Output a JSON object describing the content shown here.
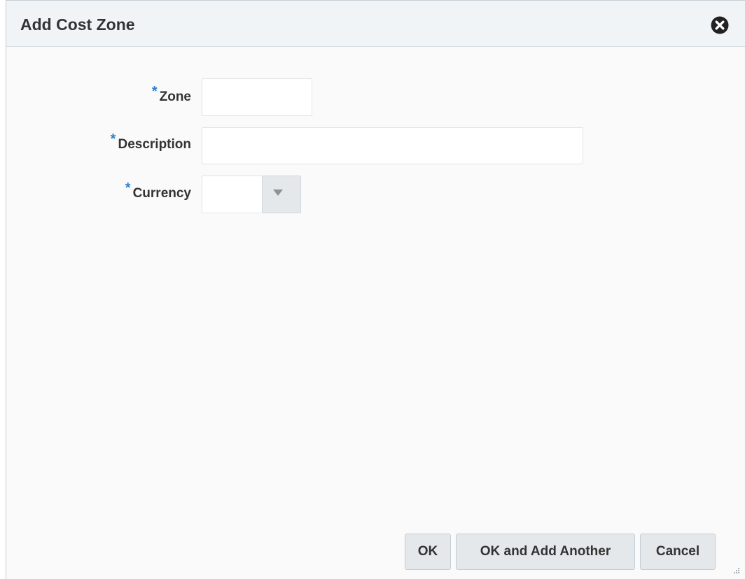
{
  "dialog": {
    "title": "Add Cost Zone",
    "close_icon": "close-circle-icon"
  },
  "form": {
    "required_marker": "*",
    "zone": {
      "label": "Zone",
      "value": ""
    },
    "description": {
      "label": "Description",
      "value": ""
    },
    "currency": {
      "label": "Currency",
      "value": ""
    }
  },
  "buttons": {
    "ok_label": "OK",
    "ok_add_another_label": "OK and Add Another",
    "cancel_label": "Cancel"
  },
  "colors": {
    "required_accent": "#2f7fce",
    "title_bar": "#f1f4f6",
    "button_bg": "#e4e8ea"
  }
}
